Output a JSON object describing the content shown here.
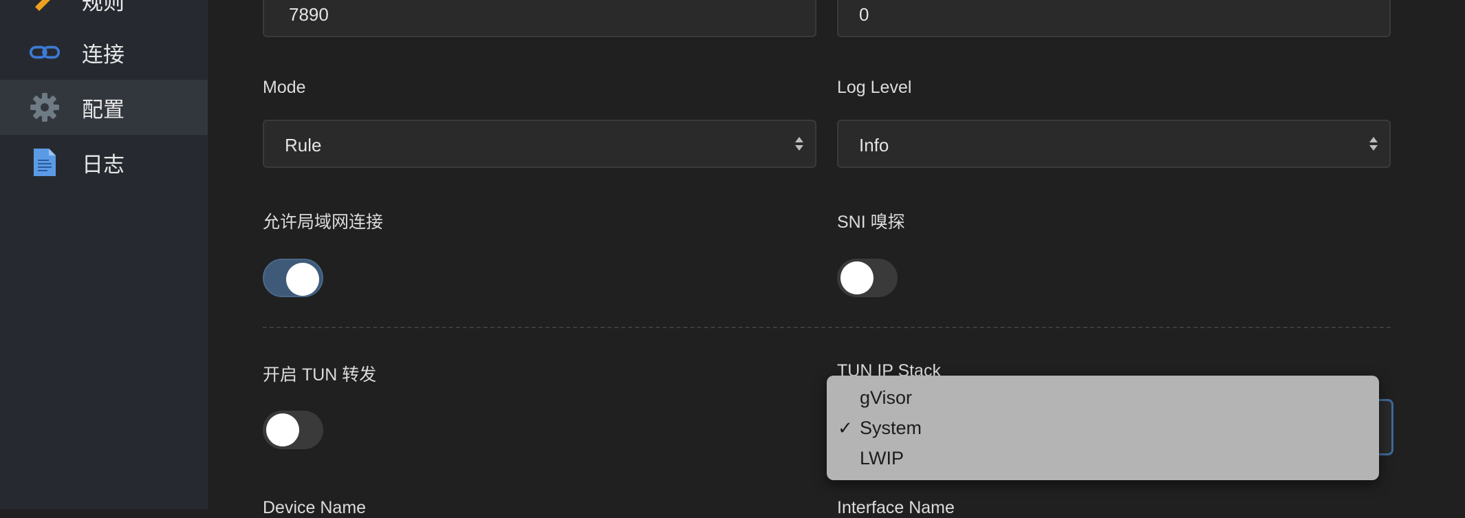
{
  "sidebar": {
    "items": [
      {
        "label": "规则",
        "icon": "ruler-icon"
      },
      {
        "label": "连接",
        "icon": "link-icon"
      },
      {
        "label": "配置",
        "icon": "gear-icon",
        "active": true
      },
      {
        "label": "日志",
        "icon": "document-icon"
      }
    ]
  },
  "form": {
    "port_left_value": "7890",
    "port_right_value": "0",
    "mode": {
      "label": "Mode",
      "value": "Rule"
    },
    "log_level": {
      "label": "Log Level",
      "value": "Info"
    },
    "allow_lan": {
      "label": "允许局域网连接",
      "enabled": true
    },
    "sni_sniff": {
      "label": "SNI 嗅探",
      "enabled": false
    },
    "tun_forward": {
      "label": "开启 TUN 转发",
      "enabled": false
    },
    "tun_ip_stack": {
      "label": "TUN IP Stack",
      "value": "System"
    },
    "device_name": {
      "label": "Device Name"
    },
    "interface_name": {
      "label": "Interface Name"
    }
  },
  "dropdown": {
    "options": [
      "gVisor",
      "System",
      "LWIP"
    ],
    "selected": "System",
    "check_glyph": "✓"
  },
  "colors": {
    "background": "#202020",
    "sidebar": "#262a30",
    "toggle_on": "#3e5a78",
    "accent_icon": "#3c7bd6",
    "dropdown_bg": "#b4b4b4"
  }
}
